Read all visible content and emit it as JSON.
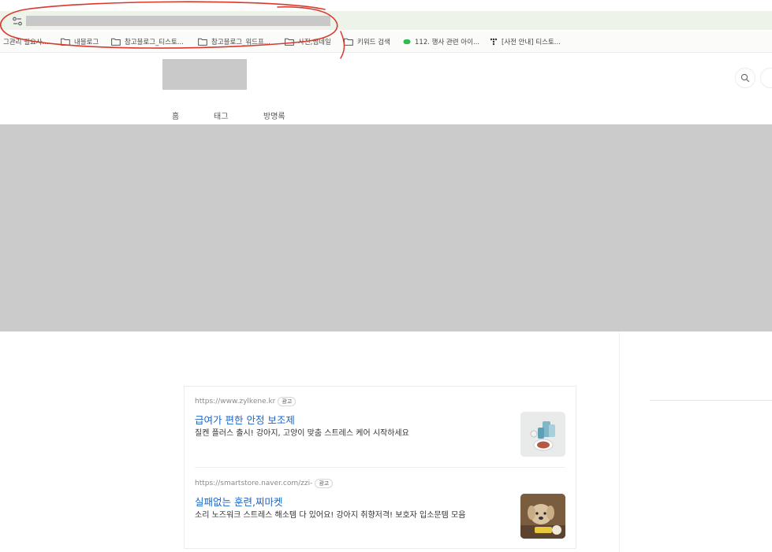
{
  "bookmarks": [
    {
      "label": "그관리 필요사...",
      "icon": "none-truncated"
    },
    {
      "label": "내블로그",
      "icon": "folder-icon"
    },
    {
      "label": "참고블로그_티스토...",
      "icon": "folder-icon"
    },
    {
      "label": "참고블로그_워드프...",
      "icon": "folder-icon"
    },
    {
      "label": "사진,썸네일",
      "icon": "folder-icon"
    },
    {
      "label": "키워드 검색",
      "icon": "folder-icon"
    },
    {
      "label": "112. 행사 관련 아이...",
      "icon": "green-pill-icon"
    },
    {
      "label": "[사전 안내] 티스토...",
      "icon": "tistory-dots-icon"
    }
  ],
  "nav": {
    "home": "홈",
    "tag": "태그",
    "guestbook": "방명록"
  },
  "ads": [
    {
      "url": "https://www.zylkene.kr",
      "badge": "광고",
      "title": "급여가 편한 안정 보조제",
      "description": "질켄 플러스 출시! 강아지, 고양이 맞춤 스트레스 케어 시작하세요",
      "thumbnail": "supplement-product-image"
    },
    {
      "url": "https://smartstore.naver.com/zzi-",
      "badge": "광고",
      "title": "실패없는 훈련,찌마켓",
      "description": "소리 노즈워크 스트레스 해소템 다 있어요! 강아지 취향저격! 보호자 입소문템 모음",
      "thumbnail": "puppy-toy-image"
    }
  ],
  "colors": {
    "address_bar": "#eef3ea",
    "redaction": "#c9c9c9",
    "annotation": "#d9382c",
    "ad_title": "#1a64c8"
  }
}
